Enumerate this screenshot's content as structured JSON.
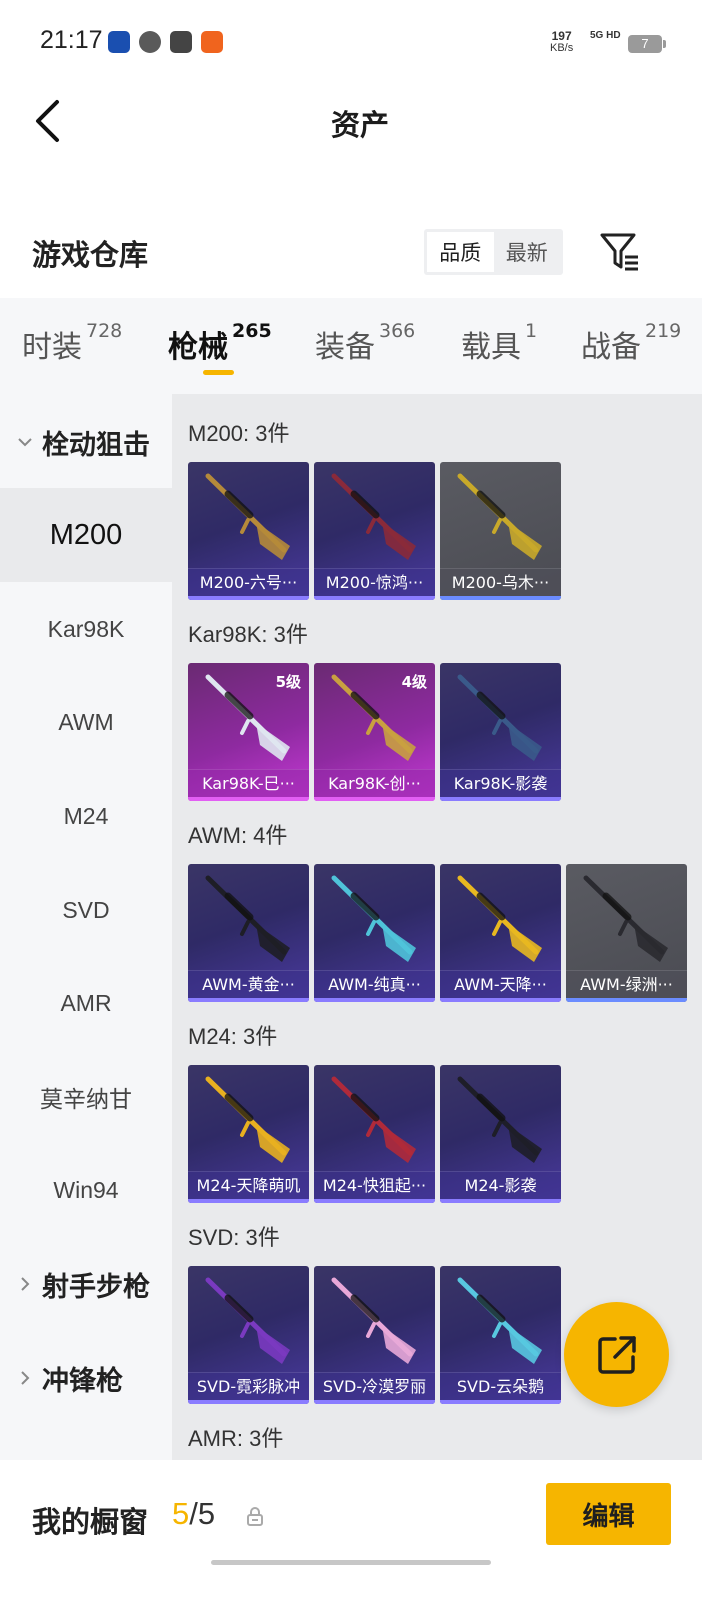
{
  "status_bar": {
    "time": "21:17",
    "speed_value": "197",
    "speed_unit": "KB/s",
    "network": "5G HD",
    "battery": "7",
    "app_icons": [
      "app-icon-blue",
      "app-icon-swirl",
      "app-icon-mail",
      "app-icon-orange"
    ]
  },
  "header": {
    "title": "资产",
    "back_icon": "chevron-left-icon"
  },
  "section": {
    "title": "游戏仓库",
    "sort_options": [
      "品质",
      "最新"
    ],
    "sort_active": "品质",
    "filter_icon": "filter-icon"
  },
  "tabs": [
    {
      "label": "时装",
      "count": "728"
    },
    {
      "label": "枪械",
      "count": "265"
    },
    {
      "label": "装备",
      "count": "366"
    },
    {
      "label": "载具",
      "count": "1"
    },
    {
      "label": "战备",
      "count": "219"
    }
  ],
  "active_tab": "枪械",
  "sidebar": {
    "groups": [
      {
        "label": "栓动狙击",
        "expanded": true
      },
      {
        "label": "射手步枪",
        "expanded": false
      },
      {
        "label": "冲锋枪",
        "expanded": false
      }
    ],
    "items": [
      "M200",
      "Kar98K",
      "AWM",
      "M24",
      "SVD",
      "AMR",
      "莫辛纳甘",
      "Win94"
    ],
    "active_item": "M200"
  },
  "weapon_groups": [
    {
      "title": "M200: 3件",
      "items": [
        {
          "name": "M200-六号···",
          "style": "purple",
          "gun_color": "#b58a3a"
        },
        {
          "name": "M200-惊鸿···",
          "style": "purple",
          "gun_color": "#8a2a3a"
        },
        {
          "name": "M200-乌木···",
          "style": "grey",
          "gun_color": "#c8a92a"
        }
      ]
    },
    {
      "title": "Kar98K: 3件",
      "items": [
        {
          "name": "Kar98K-巳···",
          "style": "pink",
          "gun_color": "#dfe6f0",
          "level": "5级"
        },
        {
          "name": "Kar98K-创···",
          "style": "pink",
          "gun_color": "#c9a040",
          "level": "4级"
        },
        {
          "name": "Kar98K-影袭",
          "style": "purple",
          "gun_color": "#3a5a8a"
        }
      ]
    },
    {
      "title": "AWM: 4件",
      "items": [
        {
          "name": "AWM-黄金···",
          "style": "purple",
          "gun_color": "#1e1e26"
        },
        {
          "name": "AWM-纯真···",
          "style": "purple",
          "gun_color": "#4fc3d9"
        },
        {
          "name": "AWM-天降···",
          "style": "purple",
          "gun_color": "#e8b820"
        },
        {
          "name": "AWM-绿洲···",
          "style": "grey",
          "gun_color": "#2a2a30"
        }
      ]
    },
    {
      "title": "M24: 3件",
      "items": [
        {
          "name": "M24-天降萌叽",
          "style": "purple",
          "gun_color": "#e8b020"
        },
        {
          "name": "M24-快狙起···",
          "style": "purple",
          "gun_color": "#b02a3a"
        },
        {
          "name": "M24-影袭",
          "style": "purple",
          "gun_color": "#1e1e28"
        }
      ]
    },
    {
      "title": "SVD: 3件",
      "items": [
        {
          "name": "SVD-霓彩脉冲",
          "style": "purple",
          "gun_color": "#7a3ac0"
        },
        {
          "name": "SVD-冷漠罗丽",
          "style": "purple",
          "gun_color": "#e8a8d8"
        },
        {
          "name": "SVD-云朵鹅",
          "style": "purple",
          "gun_color": "#58c8e0"
        }
      ]
    },
    {
      "title": "AMR: 3件",
      "items": []
    }
  ],
  "fab_icon": "share-export-icon",
  "bottom_bar": {
    "label": "我的橱窗",
    "current": "5",
    "separator": "/",
    "total": "5",
    "lock_icon": "lock-icon",
    "edit_label": "编辑"
  },
  "colors": {
    "accent": "#f6b500",
    "content_bg": "#e9eaec",
    "sidebar_bg": "#f6f7f9"
  }
}
